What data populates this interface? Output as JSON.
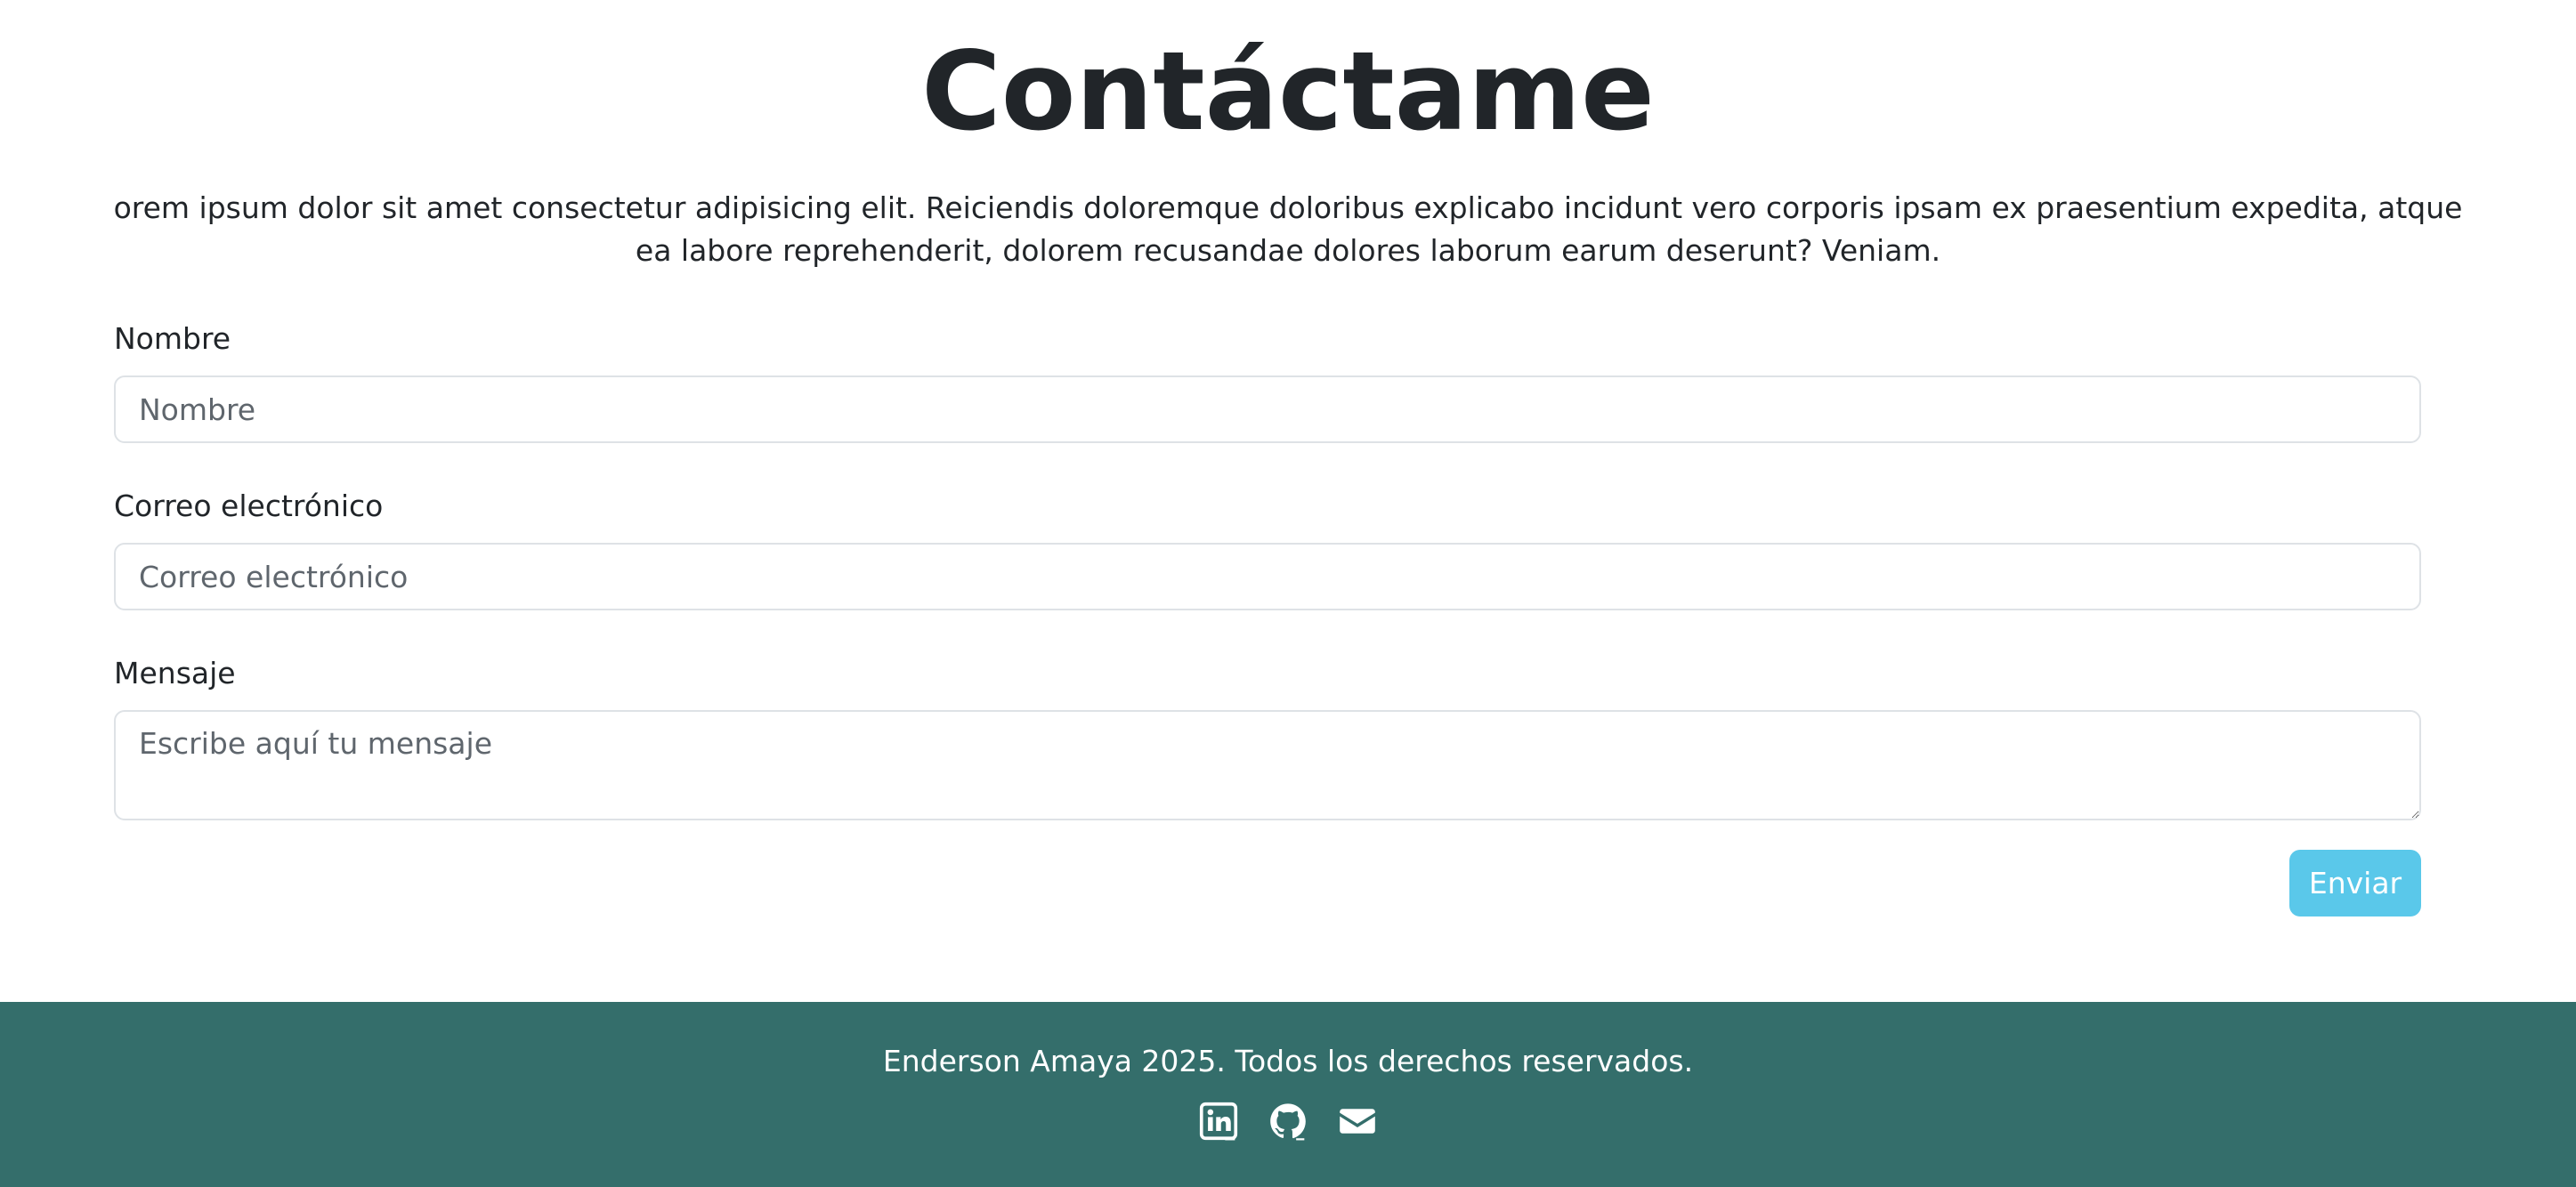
{
  "contact": {
    "title": "Contáctame",
    "intro": "orem ipsum dolor sit amet consectetur adipisicing elit. Reiciendis doloremque doloribus explicabo incidunt vero corporis ipsam ex praesentium expedita, atque ea labore reprehenderit, dolorem recusandae dolores laborum earum deserunt? Veniam.",
    "form": {
      "name_label": "Nombre",
      "name_placeholder": "Nombre",
      "name_value": "",
      "email_label": "Correo electrónico",
      "email_placeholder": "Correo electrónico",
      "email_value": "",
      "message_label": "Mensaje",
      "message_placeholder": "Escribe aquí tu mensaje",
      "message_value": "",
      "submit_label": "Enviar"
    }
  },
  "footer": {
    "copyright": "Enderson Amaya 2025. Todos los derechos reservados.",
    "social_icons": [
      "linkedin-icon",
      "github-icon",
      "envelope-icon"
    ]
  },
  "colors": {
    "accent_button": "#5ac8ea",
    "footer_background": "#346e6b",
    "text": "#212529"
  }
}
